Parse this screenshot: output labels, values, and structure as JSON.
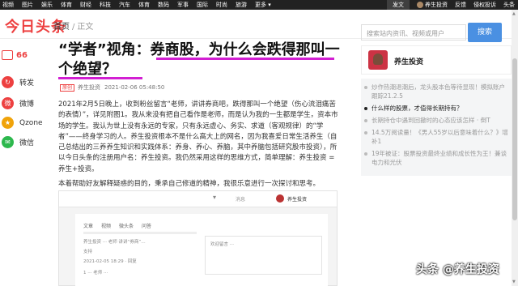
{
  "topnav": {
    "items": [
      "视频",
      "图片",
      "娱乐",
      "体育",
      "财经",
      "科技",
      "汽车",
      "体育",
      "数码",
      "军事",
      "国际",
      "时尚",
      "旅游",
      "更多 ▾"
    ],
    "right": {
      "publish": "发文",
      "user": "养生投资",
      "feedback": "反馈",
      "complaint": "侵权投诉",
      "more": "头条"
    }
  },
  "header": {
    "logo": "今日头条",
    "crumbs": {
      "home": "首页",
      "sep": "/",
      "current": "正文"
    },
    "search_placeholder": "搜索站内资讯、视频或用户",
    "search_btn": "搜索"
  },
  "share": {
    "count": "66",
    "items": [
      {
        "label": "转发",
        "icon": "repost-icon",
        "color": "#ed4040",
        "glyph": "↻"
      },
      {
        "label": "微博",
        "icon": "weibo-icon",
        "color": "#ed4040",
        "glyph": "微"
      },
      {
        "label": "Qzone",
        "icon": "qzone-icon",
        "color": "#f0a30a",
        "glyph": "★"
      },
      {
        "label": "微信",
        "icon": "wechat-icon",
        "color": "#2db84d",
        "glyph": "✉"
      }
    ]
  },
  "article": {
    "title": "“学者”视角：券商股，为什么会跌得那叫一个绝望？",
    "meta": {
      "tag": "原创",
      "author": "养生投资",
      "time": "2021-02-06 05:48:50"
    },
    "para1_a": "2021年2月5日晚上，收到粉丝留言“老师，讲讲券商吧，跌得那叫一个绝望（伤心流泪痛苦的表情）”，详见附图1。我从来没有把自己看作是老师，而是认为我的一生都是学生，资本市场的学生。我认为世上没有永远的专家，只有永远虚心、务实、求道（客观规律）的“学者”——终身学习的人。养生投资根本不是什么高大上的网名，因为我喜爱日常生活养生（自己总结出的三养养生知识和实践体系：养身、养心、养脑，其中养脑包括研究股市投资），所以今日头条的注册用户名：养生投资。我仍然采用这样的思维方式，简单理解：养生投资 = 养生+投资。",
    "para2": "本着帮助好友解释疑惑的目的，秉承自己修道的精神，我很乐意进行一次探讨和思考。"
  },
  "embed": {
    "msg": "消息",
    "name": "养生投资",
    "arrow": "▾",
    "tabs": [
      "文章",
      "视频",
      "微头条",
      "问答"
    ],
    "line1": "养生投资 ··· 老师 讲讲“券商”…",
    "line2": "支持",
    "line3": "2021-02-05 18:29 · 回复",
    "line4": "1 ··· 老师 ···",
    "placeholder": "欢迎留言 ···"
  },
  "sidebar": {
    "author_name": "养生投资",
    "items": [
      {
        "text": "炒作热潮退潮后，龙头股本色等待显现！模拟账户跟踪21.2.5",
        "active": false
      },
      {
        "text": "什么样的股票，才值得长期持有？",
        "active": true
      },
      {
        "text": "长期持仓中遇到回撤时的心态应该怎样 · 倒T",
        "active": false
      },
      {
        "text": "14.5万阅读量！《男人55岁以后意味着什么？》增补1",
        "active": false
      },
      {
        "text": "19年被证：股票投资最终业绩和成长性为王！兼谈电力和光伏",
        "active": false
      }
    ]
  },
  "watermark": "头条 @养生投资"
}
